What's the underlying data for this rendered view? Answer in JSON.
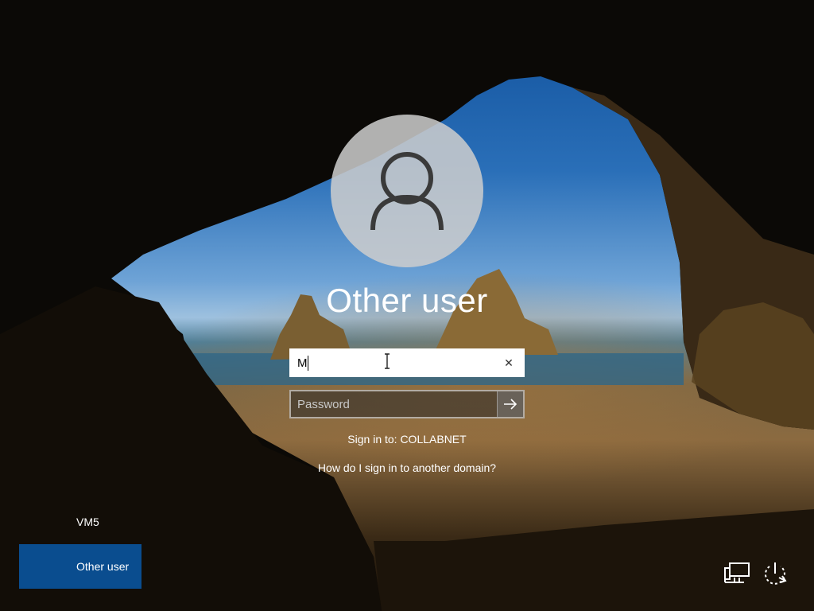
{
  "user": {
    "display_name": "Other user",
    "avatar_icon": "user-silhouette-icon"
  },
  "form": {
    "username_value": "M",
    "password_placeholder": "Password",
    "clear_icon": "close-icon",
    "submit_icon": "arrow-right-icon"
  },
  "signin_target": "Sign in to: COLLABNET",
  "domain_help_link": "How do I sign in to another domain?",
  "user_list": {
    "items": [
      "VM5",
      "Other user"
    ],
    "selected": "Other user"
  },
  "system_icons": [
    "network-icon",
    "power-icon"
  ],
  "colors": {
    "selected_tile": "#0a4d8f",
    "text": "#ffffff"
  }
}
